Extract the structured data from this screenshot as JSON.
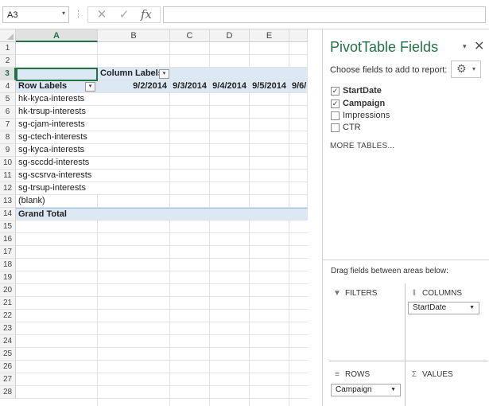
{
  "formula_bar": {
    "name_box": "A3",
    "name_box_dropdown_icon": "▾",
    "separator": "⋮",
    "cancel_icon": "✕",
    "enter_icon": "✓",
    "fx_label": "fx",
    "formula_value": ""
  },
  "sheet": {
    "column_headers": [
      "A",
      "B",
      "C",
      "D",
      "E"
    ],
    "row_numbers": [
      "1",
      "2",
      "3",
      "4",
      "5",
      "6",
      "7",
      "8",
      "9",
      "10",
      "11",
      "12",
      "13",
      "14",
      "15",
      "16",
      "17",
      "18",
      "19",
      "20",
      "21",
      "22",
      "23",
      "24",
      "25",
      "26",
      "27",
      "28"
    ],
    "selected_cell": "A3"
  },
  "pivot": {
    "column_labels": "Column Labels",
    "row_labels": "Row Labels",
    "filter_icon": "▾",
    "dates": [
      "9/2/2014",
      "9/3/2014",
      "9/4/2014",
      "9/5/2014",
      "9/6/"
    ],
    "rows": [
      "hk-kyca-interests",
      "hk-trsup-interests",
      "sg-cjam-interests",
      "sg-ctech-interests",
      "sg-kyca-interests",
      "sg-sccdd-interests",
      "sg-scsrva-interests",
      "sg-trsup-interests",
      "(blank)"
    ],
    "grand_total": "Grand Total"
  },
  "pane": {
    "title": "PivotTable Fields",
    "dropdown_icon": "▾",
    "close_icon": "✕",
    "choose_label": "Choose fields to add to report:",
    "gear_icon": "⚙",
    "gear_dropdown_icon": "▾",
    "check_mark": "✓",
    "fields": [
      {
        "label": "StartDate",
        "checked": true
      },
      {
        "label": "Campaign",
        "checked": true
      },
      {
        "label": "Impressions",
        "checked": false
      },
      {
        "label": "CTR",
        "checked": false
      }
    ],
    "more_tables": "MORE TABLES...",
    "drag_label": "Drag fields between areas below:",
    "areas": {
      "filters": {
        "icon": "▼",
        "title": "FILTERS"
      },
      "columns": {
        "icon": "‖",
        "title": "COLUMNS",
        "chip": "StartDate"
      },
      "rows": {
        "icon": "≡",
        "title": "ROWS",
        "chip": "Campaign"
      },
      "values": {
        "icon": "Σ",
        "title": "VALUES"
      }
    },
    "chip_dropdown_icon": "▼"
  }
}
